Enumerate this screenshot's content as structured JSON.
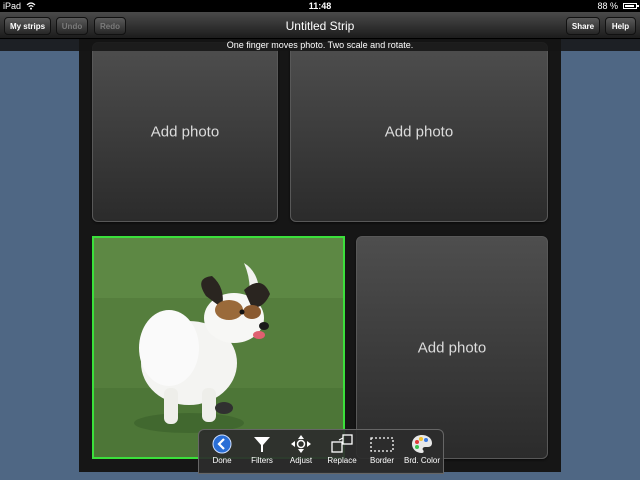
{
  "status_bar": {
    "device": "iPad",
    "time": "11:48",
    "battery": "88 %",
    "battery_level": 0.88
  },
  "nav": {
    "title": "Untitled Strip",
    "my_strips": "My strips",
    "undo": "Undo",
    "redo": "Redo",
    "share": "Share",
    "help": "Help"
  },
  "hint": "One finger moves photo. Two scale and rotate.",
  "panels": {
    "top_left": "Add photo",
    "top_right": "Add photo",
    "bottom_right": "Add photo"
  },
  "toolbar": {
    "done": "Done",
    "filters": "Filters",
    "adjust": "Adjust",
    "replace": "Replace",
    "border": "Border",
    "brd_color": "Brd. Color"
  },
  "colors": {
    "selection": "#3be03b",
    "done_icon": "#2a6fd6",
    "background": "#4f6784"
  }
}
